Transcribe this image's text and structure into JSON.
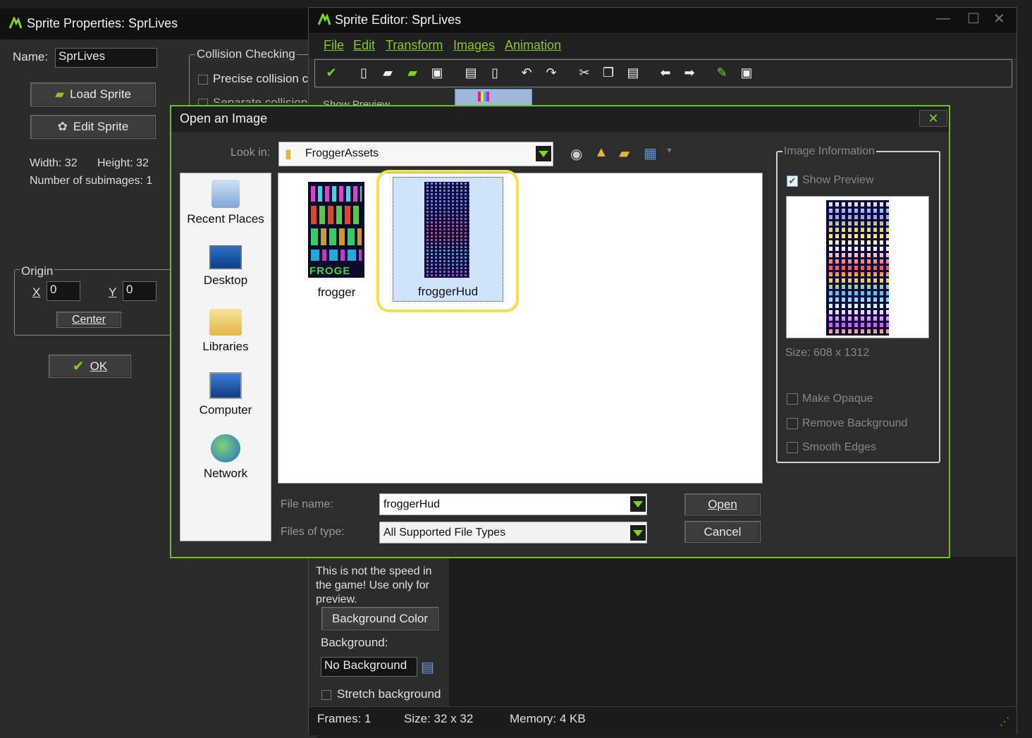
{
  "sprite_properties": {
    "title": "Sprite Properties: SprLives",
    "name_label": "Name:",
    "name_value": "SprLives",
    "load_sprite": "Load Sprite",
    "edit_sprite": "Edit Sprite",
    "width": "Width: 32",
    "height": "Height: 32",
    "subimages": "Number of subimages: 1",
    "collision_group": "Collision Checking",
    "precise_collision": "Precise collision ch",
    "separate_collision": "Separate collision m",
    "origin_group": "Origin",
    "x_label": "X",
    "x_value": "0",
    "y_label": "Y",
    "y_value": "0",
    "center": "Center",
    "ok": "OK"
  },
  "sprite_editor": {
    "title": "Sprite Editor: SprLives",
    "menu": [
      "File",
      "Edit",
      "Transform",
      "Images",
      "Animation"
    ],
    "show_preview_partial": "Show Preview",
    "speed_note": "This is not the speed in the game! Use only for preview.",
    "background_color": "Background Color",
    "background_label": "Background:",
    "background_value": "No Background",
    "stretch_background": "Stretch background",
    "status": {
      "frames": "Frames: 1",
      "size": "Size: 32 x 32",
      "memory": "Memory: 4 KB"
    }
  },
  "dialog": {
    "title": "Open an Image",
    "look_in_label": "Look in:",
    "look_in_value": "FroggerAssets",
    "places": [
      "Recent Places",
      "Desktop",
      "Libraries",
      "Computer",
      "Network"
    ],
    "files": [
      {
        "name": "frogger",
        "selected": false
      },
      {
        "name": "froggerHud",
        "selected": true
      }
    ],
    "frog_thumbnail_text": "FROGE",
    "file_name_label": "File name:",
    "file_name_value": "froggerHud",
    "file_type_label": "Files of type:",
    "file_type_value": "All Supported File Types",
    "open": "Open",
    "cancel": "Cancel",
    "image_info": {
      "group": "Image Information",
      "show_preview": "Show Preview",
      "size": "Size: 608 x 1312",
      "make_opaque": "Make Opaque",
      "remove_background": "Remove Background",
      "smooth_edges": "Smooth Edges"
    }
  },
  "colors": {
    "accent": "#7ed321",
    "highlight_ring": "#f2e24a",
    "selection": "#cfe4fb"
  }
}
